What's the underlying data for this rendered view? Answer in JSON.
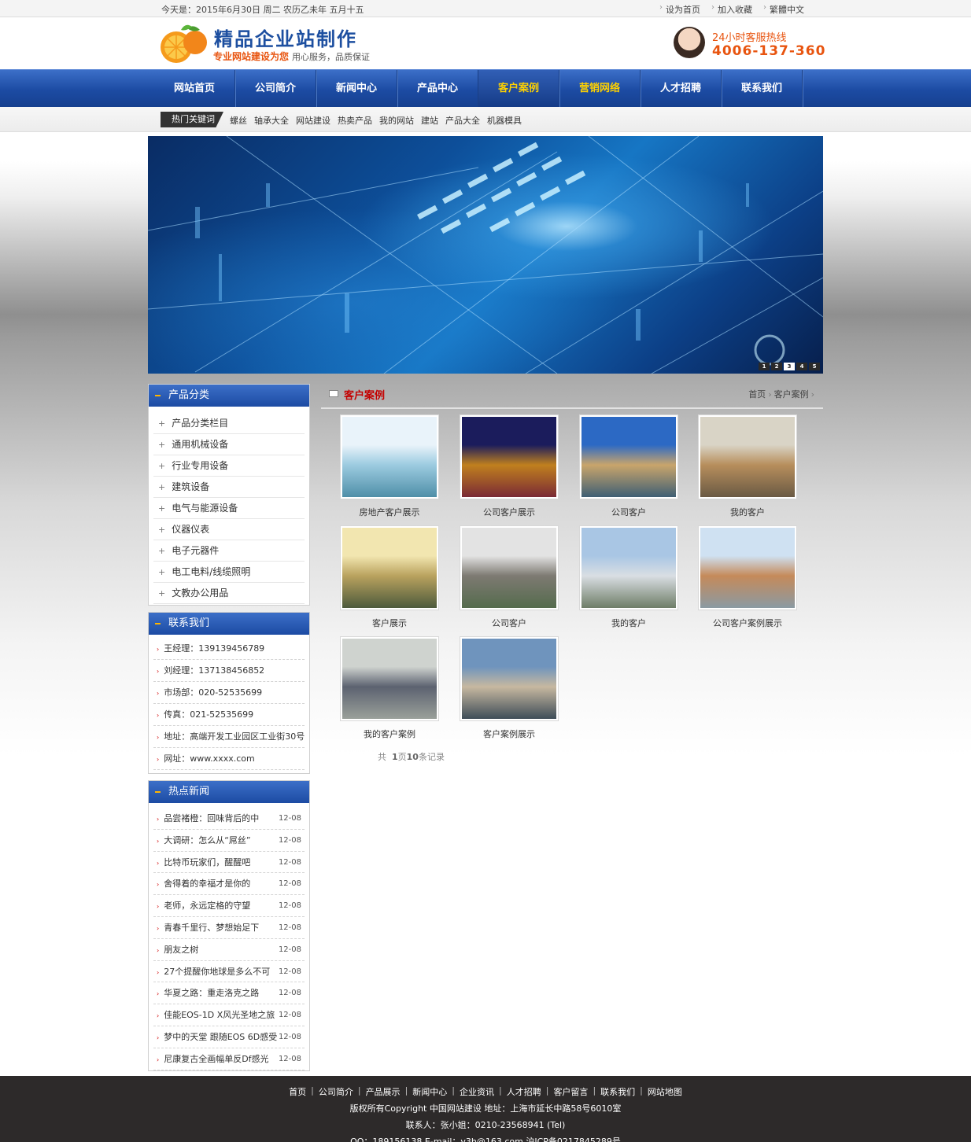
{
  "topbar": {
    "date_text": "今天是：2015年6月30日  周二  农历乙未年  五月十五",
    "links": [
      "设为首页",
      "加入收藏",
      "繁體中文"
    ]
  },
  "header": {
    "logo_title": "精品企业站制作",
    "logo_sub_em": "专业网站建设为您",
    "logo_sub_plain": "用心服务，品质保证",
    "hotline_title": "24小时客服热线",
    "hotline_number": "4006-137-360"
  },
  "nav": {
    "items": [
      "网站首页",
      "公司简介",
      "新闻中心",
      "产品中心",
      "客户案例",
      "营销网络",
      "人才招聘",
      "联系我们"
    ],
    "active_index": 4
  },
  "keywords": {
    "label": "热门关键词",
    "items": [
      "螺丝",
      "轴承大全",
      "网站建设",
      "热卖产品",
      "我的网站",
      "建站",
      "产品大全",
      "机器模具"
    ]
  },
  "banner": {
    "dots": [
      "1",
      "2",
      "3",
      "4",
      "5"
    ],
    "active_dot": 2
  },
  "sidebar": {
    "categories": {
      "title": "产品分类",
      "items": [
        "产品分类栏目",
        "通用机械设备",
        "行业专用设备",
        "建筑设备",
        "电气与能源设备",
        "仪器仪表",
        "电子元器件",
        "电工电料/线缆照明",
        "文教办公用品"
      ]
    },
    "contact": {
      "title": "联系我们",
      "items": [
        "王经理：139139456789",
        "刘经理：137138456852",
        "市场部：020-52535699",
        "传真：021-52535699",
        "地址：高端开发工业园区工业街30号",
        "网址：www.xxxx.com"
      ]
    },
    "news": {
      "title": "热点新闻",
      "items": [
        {
          "title": "品尝褚橙：回味背后的中",
          "date": "12-08"
        },
        {
          "title": "大调研：怎么从“屌丝”",
          "date": "12-08"
        },
        {
          "title": "比特币玩家们，醒醒吧",
          "date": "12-08"
        },
        {
          "title": "舍得着的幸福才是你的",
          "date": "12-08"
        },
        {
          "title": "老师，永远定格的守望",
          "date": "12-08"
        },
        {
          "title": "青春千里行、梦想始足下",
          "date": "12-08"
        },
        {
          "title": "朋友之树",
          "date": "12-08"
        },
        {
          "title": "27个提醒你地球是多么不可",
          "date": "12-08"
        },
        {
          "title": "华夏之路：重走洛克之路",
          "date": "12-08"
        },
        {
          "title": "佳能EOS-1D X风光圣地之旅",
          "date": "12-08"
        },
        {
          "title": "梦中的天堂 跟随EOS 6D感受",
          "date": "12-08"
        },
        {
          "title": "尼康复古全画幅单反Df感光",
          "date": "12-08"
        }
      ]
    }
  },
  "main": {
    "title": "客户案例",
    "breadcrumb": [
      "首页",
      "客户案例"
    ],
    "cases": [
      {
        "caption": "房地产客户展示",
        "palette": [
          "#e9f3fa",
          "#9ccbe0",
          "#4f8fa8"
        ]
      },
      {
        "caption": "公司客户展示",
        "palette": [
          "#1b1c5c",
          "#c0801e",
          "#7a2a35"
        ]
      },
      {
        "caption": "公司客户",
        "palette": [
          "#2c69c4",
          "#c9a56b",
          "#3f5f74"
        ]
      },
      {
        "caption": "我的客户",
        "palette": [
          "#d9d4c6",
          "#b78e5c",
          "#6a5a44"
        ]
      },
      {
        "caption": "客户展示",
        "palette": [
          "#f2e6b0",
          "#b9a25e",
          "#4c5a3c"
        ]
      },
      {
        "caption": "公司客户",
        "palette": [
          "#e3e3e3",
          "#7d7a72",
          "#556b4d"
        ]
      },
      {
        "caption": "我的客户",
        "palette": [
          "#a9c6e4",
          "#d9dee3",
          "#6e7d67"
        ]
      },
      {
        "caption": "公司客户案例展示",
        "palette": [
          "#cfe1f2",
          "#c58a5a",
          "#8b9aa3"
        ]
      },
      {
        "caption": "我的客户案例",
        "palette": [
          "#cfd3cf",
          "#5c6270",
          "#9aa09a"
        ]
      },
      {
        "caption": "客户案例展示",
        "palette": [
          "#6f94bd",
          "#c7b8a0",
          "#3e4d58"
        ]
      }
    ],
    "pager": {
      "prefix": "共",
      "pages": "1",
      "page_word": "页",
      "records": "10",
      "suffix": "条记录"
    }
  },
  "footer": {
    "links": [
      "首页",
      "公司简介",
      "产品展示",
      "新闻中心",
      "企业资讯",
      "人才招聘",
      "客户留言",
      "联系我们",
      "网站地图"
    ],
    "line1": "版权所有Copyright 中国网站建设  地址：上海市延长中路58号6010室",
    "line2": "联系人：张小姐：0210-23568941 (Tel)",
    "line3": "QQ：189156138 E-mail：v3h@163.com 沪ICP备0217845289号"
  }
}
